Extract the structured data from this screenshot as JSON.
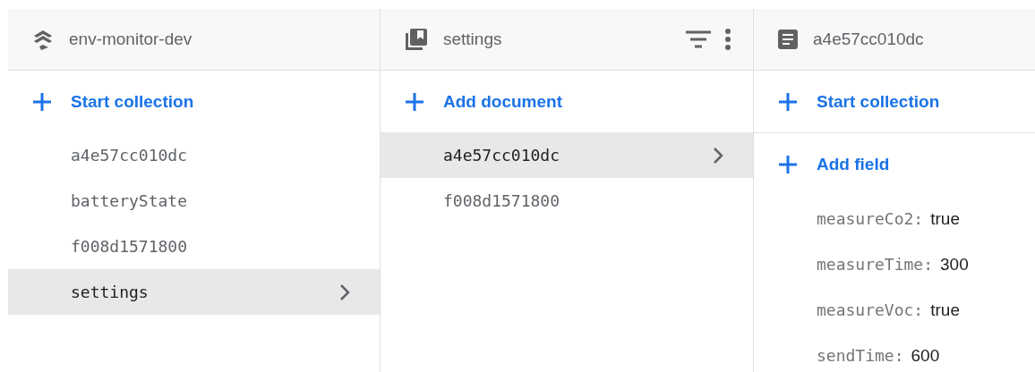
{
  "panels": [
    {
      "kind": "collections",
      "title": "env-monitor-dev",
      "action": "Start collection",
      "has_tools": false,
      "items": [
        {
          "label": "a4e57cc010dc",
          "selected": false
        },
        {
          "label": "batteryState",
          "selected": false
        },
        {
          "label": "f008d1571800",
          "selected": false
        },
        {
          "label": "settings",
          "selected": true
        }
      ]
    },
    {
      "kind": "documents",
      "title": "settings",
      "action": "Add document",
      "has_tools": true,
      "items": [
        {
          "label": "a4e57cc010dc",
          "selected": true
        },
        {
          "label": "f008d1571800",
          "selected": false
        }
      ]
    },
    {
      "kind": "document",
      "title": "a4e57cc010dc",
      "action": "Start collection",
      "has_tools": false,
      "field_action": "Add field",
      "fields": [
        {
          "key": "measureCo2:",
          "value": "true"
        },
        {
          "key": "measureTime:",
          "value": "300"
        },
        {
          "key": "measureVoc:",
          "value": "true"
        },
        {
          "key": "sendTime:",
          "value": "600"
        }
      ]
    }
  ]
}
